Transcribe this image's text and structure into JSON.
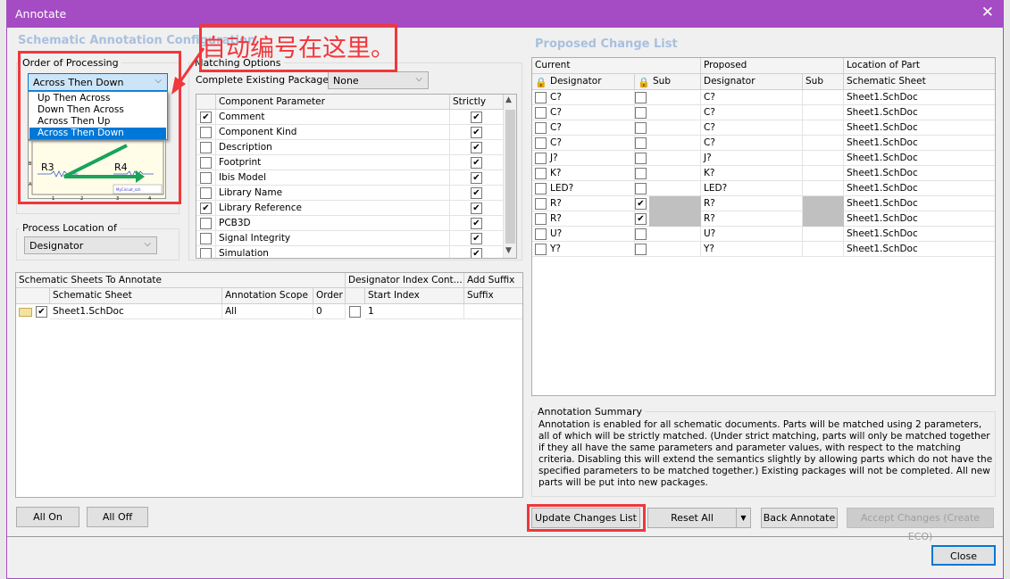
{
  "window": {
    "title": "Annotate"
  },
  "left": {
    "section_title": "Schematic Annotation Configuration",
    "order_label": "Order of Processing",
    "order_selected": "Across Then Down",
    "order_options": [
      "Up Then Across",
      "Down Then Across",
      "Across Then Up",
      "Across Then Down"
    ],
    "preview": {
      "r3": "R3",
      "r4": "R4",
      "sheet_label": "MyCircuit_sch",
      "cols": [
        "1",
        "2",
        "3",
        "4"
      ],
      "rows": [
        "B",
        "A"
      ]
    },
    "location_label": "Process Location of",
    "location_selected": "Designator",
    "matching": {
      "label": "Matching Options",
      "complete_label": "Complete Existing Packages",
      "complete_value": "None",
      "headers": [
        "Component Parameter",
        "Strictly"
      ],
      "params": [
        {
          "name": "Comment",
          "checked": true,
          "strict": true
        },
        {
          "name": "Component Kind",
          "checked": false,
          "strict": true
        },
        {
          "name": "Description",
          "checked": false,
          "strict": true
        },
        {
          "name": "Footprint",
          "checked": false,
          "strict": true
        },
        {
          "name": "Ibis Model",
          "checked": false,
          "strict": true
        },
        {
          "name": "Library Name",
          "checked": false,
          "strict": true
        },
        {
          "name": "Library Reference",
          "checked": true,
          "strict": true
        },
        {
          "name": "PCB3D",
          "checked": false,
          "strict": true
        },
        {
          "name": "Signal Integrity",
          "checked": false,
          "strict": true
        },
        {
          "name": "Simulation",
          "checked": false,
          "strict": true
        }
      ]
    },
    "sheets": {
      "group_headers": [
        "Schematic Sheets To Annotate",
        "Designator Index Cont...",
        "Add Suffix"
      ],
      "headers": [
        "Schematic Sheet",
        "Annotation Scope",
        "Order",
        "Start Index",
        "Suffix"
      ],
      "rows": [
        {
          "sheet": "Sheet1.SchDoc",
          "checked": true,
          "scope": "All",
          "order": "0",
          "index_checked": false,
          "start": "1",
          "suffix": ""
        }
      ]
    },
    "all_on": "All On",
    "all_off": "All Off"
  },
  "annotation_note": "自动编号在这里。",
  "right": {
    "section_title": "Proposed Change List",
    "group_headers": [
      "Current",
      "Proposed",
      "Location of Part"
    ],
    "headers": [
      "Designator",
      "Sub",
      "Designator",
      "Sub",
      "Schematic Sheet"
    ],
    "rows": [
      {
        "cur": "C?",
        "sub_locked": false,
        "prop": "C?",
        "sheet": "Sheet1.SchDoc"
      },
      {
        "cur": "C?",
        "sub_locked": false,
        "prop": "C?",
        "sheet": "Sheet1.SchDoc"
      },
      {
        "cur": "C?",
        "sub_locked": false,
        "prop": "C?",
        "sheet": "Sheet1.SchDoc"
      },
      {
        "cur": "C?",
        "sub_locked": false,
        "prop": "C?",
        "sheet": "Sheet1.SchDoc"
      },
      {
        "cur": "J?",
        "sub_locked": false,
        "prop": "J?",
        "sheet": "Sheet1.SchDoc"
      },
      {
        "cur": "K?",
        "sub_locked": false,
        "prop": "K?",
        "sheet": "Sheet1.SchDoc"
      },
      {
        "cur": "LED?",
        "sub_locked": false,
        "prop": "LED?",
        "sheet": "Sheet1.SchDoc"
      },
      {
        "cur": "R?",
        "sub_locked": true,
        "prop": "R?",
        "sheet": "Sheet1.SchDoc"
      },
      {
        "cur": "R?",
        "sub_locked": true,
        "prop": "R?",
        "sheet": "Sheet1.SchDoc"
      },
      {
        "cur": "U?",
        "sub_locked": false,
        "prop": "U?",
        "sheet": "Sheet1.SchDoc"
      },
      {
        "cur": "Y?",
        "sub_locked": false,
        "prop": "Y?",
        "sheet": "Sheet1.SchDoc"
      }
    ],
    "summary_label": "Annotation Summary",
    "summary_text": "Annotation is enabled for all schematic documents. Parts will be matched using 2 parameters, all of which will be strictly matched. (Under strict matching, parts will only be matched together if they all have the same parameters and parameter values, with respect to the matching criteria. Disabling this will extend the semantics slightly by allowing parts which do not have the specified parameters to be matched together.) Existing packages will not be completed. All new parts will be put into new packages.",
    "update": "Update Changes List",
    "reset": "Reset All",
    "back": "Back Annotate",
    "accept": "Accept Changes (Create ECO)"
  },
  "close": "Close",
  "colors": {
    "title_bar": "#a54cc4",
    "highlight": "#0078d7",
    "annotation_red": "#f0373b",
    "arrow_green": "#1aa35a"
  }
}
